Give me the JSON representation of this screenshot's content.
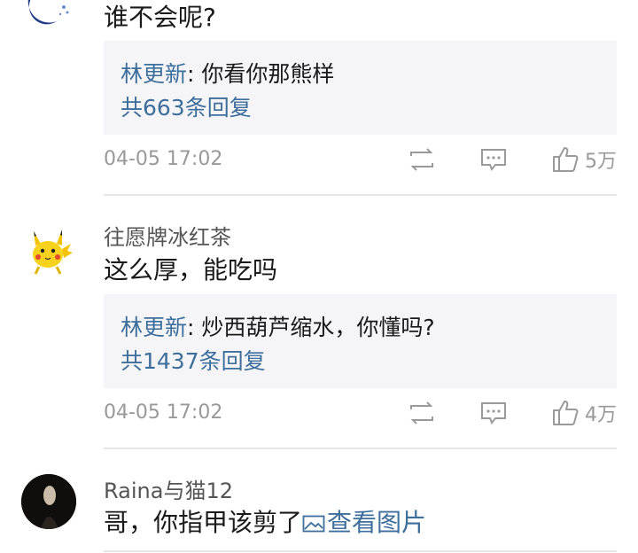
{
  "comments": [
    {
      "avatar": "moon-avatar",
      "text": "谁不会呢?",
      "reply": {
        "author": "林更新",
        "separator": ": ",
        "text": "你看你那熊样",
        "count_label": "共663条回复"
      },
      "time": "04-05 17:02",
      "likes": "5万",
      "icons": [
        "repost-icon",
        "comment-icon",
        "like-icon"
      ]
    },
    {
      "avatar": "pikachu-avatar",
      "username": "往愿牌冰红茶",
      "text": "这么厚，能吃吗",
      "reply": {
        "author": "林更新",
        "separator": ": ",
        "text": "炒西葫芦缩水，你懂吗?",
        "count_label": "共1437条回复"
      },
      "time": "04-05 17:02",
      "likes": "4万",
      "icons": [
        "repost-icon",
        "comment-icon",
        "like-icon"
      ]
    },
    {
      "avatar": "dark-portrait-avatar",
      "username": "Raina与猫12",
      "text": "哥，你指甲该剪了",
      "image_link": "查看图片",
      "icons": [
        "image-icon"
      ]
    }
  ],
  "colors": {
    "link": "#3d6e9c",
    "meta": "#999999",
    "reply_bg": "#f5f5f7",
    "divider": "#e6e6e6"
  }
}
